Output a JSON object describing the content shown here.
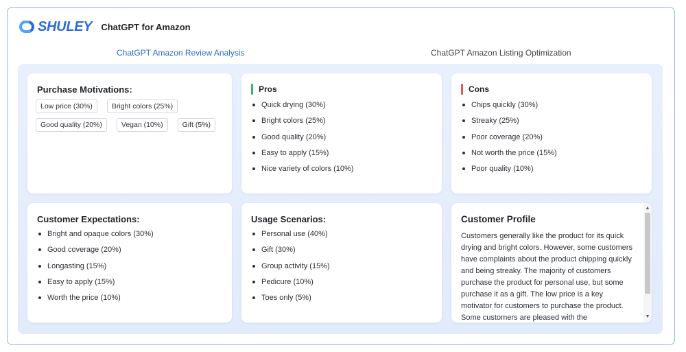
{
  "brand": {
    "name": "SHULEY",
    "logo_icon": "shuley-logo-icon",
    "color": "#2a6bd9"
  },
  "app_title": "ChatGPT for Amazon",
  "tabs": [
    {
      "label": "ChatGPT Amazon Review Analysis",
      "active": true
    },
    {
      "label": "ChatGPT Amazon Listing Optimization",
      "active": false
    }
  ],
  "purchase_motivations": {
    "title": "Purchase Motivations:",
    "tags": [
      "Low price (30%)",
      "Bright colors (25%)",
      "Good quality (20%)",
      "Vegan (10%)",
      "Gift (5%)"
    ]
  },
  "pros": {
    "title": "Pros",
    "accent": "#3cb371",
    "items": [
      "Quick drying (30%)",
      "Bright colors (25%)",
      "Good quality (20%)",
      "Easy to apply (15%)",
      "Nice variety of colors (10%)"
    ]
  },
  "cons": {
    "title": "Cons",
    "accent": "#e05a4e",
    "items": [
      "Chips quickly (30%)",
      "Streaky (25%)",
      "Poor coverage (20%)",
      "Not worth the price (15%)",
      "Poor quality (10%)"
    ]
  },
  "customer_expectations": {
    "title": "Customer Expectations:",
    "items": [
      "Bright and opaque colors (30%)",
      "Good coverage (20%)",
      "Longasting (15%)",
      "Easy to apply (15%)",
      "Worth the price (10%)"
    ]
  },
  "usage_scenarios": {
    "title": "Usage Scenarios:",
    "items": [
      "Personal use (40%)",
      "Gift (30%)",
      "Group activity (15%)",
      "Pedicure (10%)",
      "Toes only (5%)"
    ]
  },
  "customer_profile": {
    "title": "Customer Profile",
    "text": "Customers generally like the product for its quick drying and bright colors. However, some customers have complaints about the product chipping quickly and being streaky. The majority of customers purchase the product for personal use, but some purchase it as a gift. The low price is a key motivator for customers to purchase the product. Some customers are pleased with the"
  }
}
